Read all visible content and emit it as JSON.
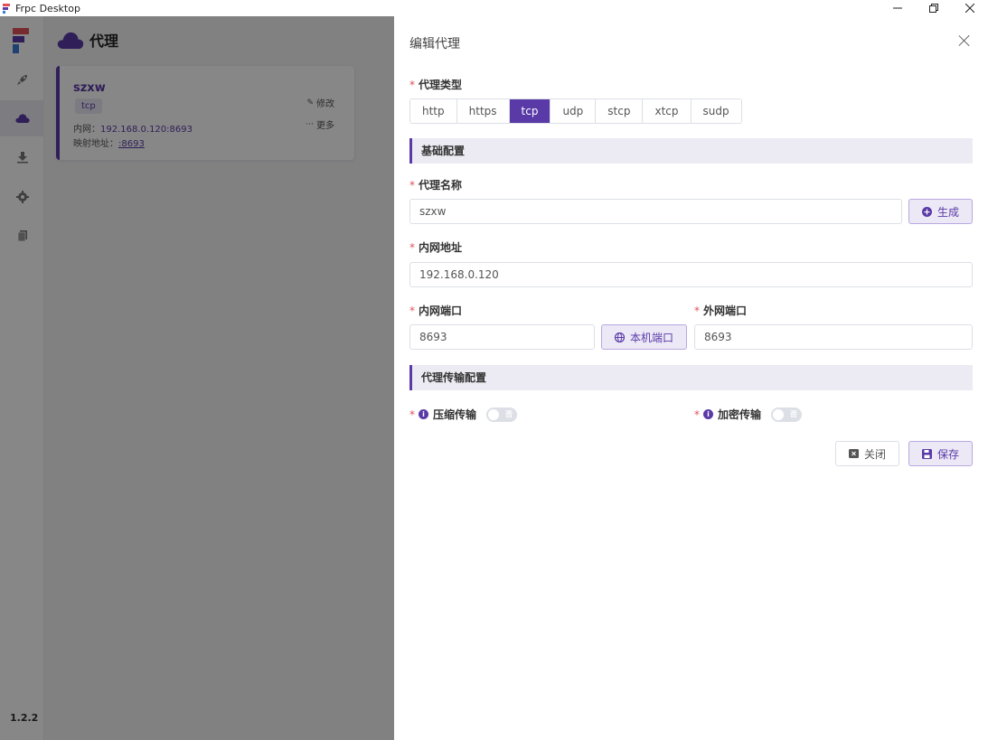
{
  "window": {
    "title": "Frpc Desktop",
    "min_icon": "minimize-icon",
    "max_icon": "restore-icon",
    "close_icon": "close-icon"
  },
  "sidebar": {
    "items": [
      {
        "name": "rocket",
        "icon": "rocket-icon"
      },
      {
        "name": "proxy",
        "icon": "cloud-icon",
        "active": true
      },
      {
        "name": "download",
        "icon": "download-icon"
      },
      {
        "name": "settings",
        "icon": "gear-icon"
      },
      {
        "name": "logs",
        "icon": "document-icon"
      }
    ],
    "version": "1.2.2"
  },
  "main": {
    "title": "代理",
    "cards": [
      {
        "name": "szxw",
        "type": "tcp",
        "local_label": "内网：",
        "local_value": "192.168.0.120:8693",
        "mapped_label": "映射地址：",
        "mapped_value": ":8693",
        "edit_label": "修改",
        "more_label": "更多"
      }
    ]
  },
  "drawer": {
    "title": "编辑代理",
    "required_mark": "*",
    "proxy_type_label": "代理类型",
    "proxy_types": [
      "http",
      "https",
      "tcp",
      "udp",
      "stcp",
      "xtcp",
      "sudp"
    ],
    "selected_type": "tcp",
    "section_basic": "基础配置",
    "name_label": "代理名称",
    "name_value": "szxw",
    "generate_button": "生成",
    "local_ip_label": "内网地址",
    "local_ip_value": "192.168.0.120",
    "local_port_label": "内网端口",
    "local_port_value": "8693",
    "local_port_button": "本机端口",
    "remote_port_label": "外网端口",
    "remote_port_value": "8693",
    "section_transport": "代理传输配置",
    "compress_label": "压缩传输",
    "encrypt_label": "加密传输",
    "switch_off_text": "否",
    "compress_on": false,
    "encrypt_on": false,
    "close_button": "关闭",
    "save_button": "保存",
    "accent_color": "#5a3aa7"
  }
}
